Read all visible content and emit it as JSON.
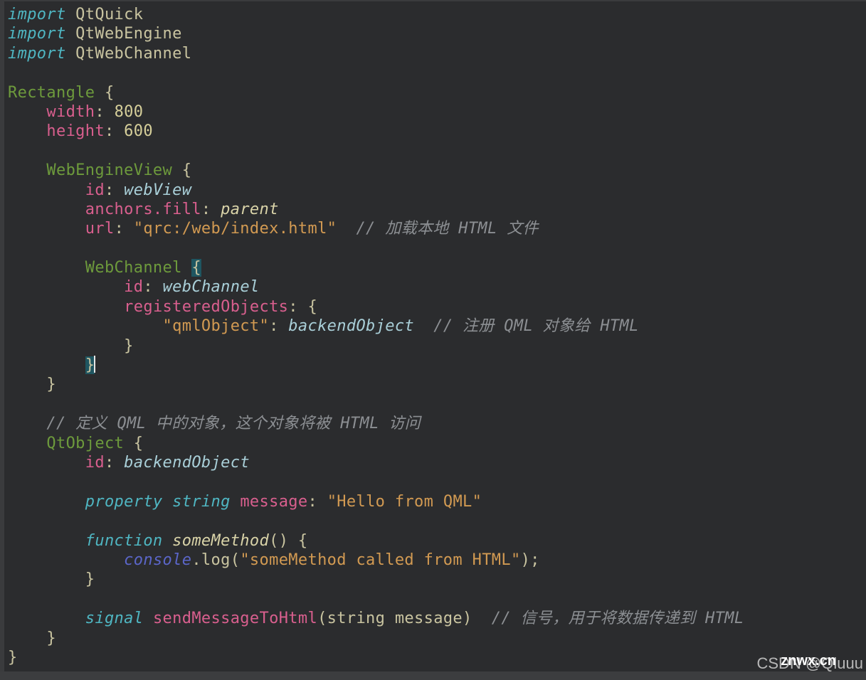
{
  "editor": {
    "language": "QML",
    "lines": [
      [
        {
          "t": "import",
          "c": "kw"
        },
        {
          "t": " QtQuick",
          "c": "plain"
        }
      ],
      [
        {
          "t": "import",
          "c": "kw"
        },
        {
          "t": " QtWebEngine",
          "c": "plain"
        }
      ],
      [
        {
          "t": "import",
          "c": "kw"
        },
        {
          "t": " QtWebChannel",
          "c": "plain"
        }
      ],
      [],
      [
        {
          "t": "Rectangle",
          "c": "type"
        },
        {
          "t": " {",
          "c": "plain"
        }
      ],
      [
        {
          "t": "    "
        },
        {
          "t": "width",
          "c": "prop"
        },
        {
          "t": ": ",
          "c": "plain"
        },
        {
          "t": "800",
          "c": "num"
        }
      ],
      [
        {
          "t": "    "
        },
        {
          "t": "height",
          "c": "prop"
        },
        {
          "t": ": ",
          "c": "plain"
        },
        {
          "t": "600",
          "c": "num"
        }
      ],
      [],
      [
        {
          "t": "    "
        },
        {
          "t": "WebEngineView",
          "c": "type"
        },
        {
          "t": " {",
          "c": "plain"
        }
      ],
      [
        {
          "t": "        "
        },
        {
          "t": "id",
          "c": "prop"
        },
        {
          "t": ": ",
          "c": "plain"
        },
        {
          "t": "webView",
          "c": "ital"
        }
      ],
      [
        {
          "t": "        "
        },
        {
          "t": "anchors.fill",
          "c": "prop"
        },
        {
          "t": ": ",
          "c": "plain"
        },
        {
          "t": "parent",
          "c": "fn"
        }
      ],
      [
        {
          "t": "        "
        },
        {
          "t": "url",
          "c": "prop"
        },
        {
          "t": ": ",
          "c": "plain"
        },
        {
          "t": "\"qrc:/web/index.html\"",
          "c": "str"
        },
        {
          "t": "  // 加载本地 HTML 文件",
          "c": "com"
        }
      ],
      [],
      [
        {
          "t": "        "
        },
        {
          "t": "WebChannel",
          "c": "type"
        },
        {
          "t": " ",
          "c": "plain"
        },
        {
          "t": "{",
          "c": "plain brace-hl"
        }
      ],
      [
        {
          "t": "            "
        },
        {
          "t": "id",
          "c": "prop"
        },
        {
          "t": ": ",
          "c": "plain"
        },
        {
          "t": "webChannel",
          "c": "ital"
        }
      ],
      [
        {
          "t": "            "
        },
        {
          "t": "registeredObjects",
          "c": "prop"
        },
        {
          "t": ": {",
          "c": "plain"
        }
      ],
      [
        {
          "t": "                "
        },
        {
          "t": "\"qmlObject\"",
          "c": "str"
        },
        {
          "t": ": ",
          "c": "plain"
        },
        {
          "t": "backendObject",
          "c": "ital"
        },
        {
          "t": "  // 注册 QML 对象给 HTML",
          "c": "com"
        }
      ],
      [
        {
          "t": "            "
        },
        {
          "t": "}",
          "c": "plain"
        }
      ],
      [
        {
          "t": "        "
        },
        {
          "t": "}",
          "c": "plain brace-hl"
        },
        {
          "t": "",
          "c": "cursor"
        }
      ],
      [
        {
          "t": "    "
        },
        {
          "t": "}",
          "c": "plain"
        }
      ],
      [],
      [
        {
          "t": "    "
        },
        {
          "t": "// 定义 QML 中的对象，这个对象将被 HTML 访问",
          "c": "com"
        }
      ],
      [
        {
          "t": "    "
        },
        {
          "t": "QtObject",
          "c": "type"
        },
        {
          "t": " {",
          "c": "plain"
        }
      ],
      [
        {
          "t": "        "
        },
        {
          "t": "id",
          "c": "prop"
        },
        {
          "t": ": ",
          "c": "plain"
        },
        {
          "t": "backendObject",
          "c": "ital"
        }
      ],
      [],
      [
        {
          "t": "        "
        },
        {
          "t": "property",
          "c": "kw"
        },
        {
          "t": " "
        },
        {
          "t": "string",
          "c": "kw"
        },
        {
          "t": " "
        },
        {
          "t": "message",
          "c": "prop"
        },
        {
          "t": ": ",
          "c": "plain"
        },
        {
          "t": "\"Hello from QML\"",
          "c": "str"
        }
      ],
      [],
      [
        {
          "t": "        "
        },
        {
          "t": "function",
          "c": "kw"
        },
        {
          "t": " "
        },
        {
          "t": "someMethod",
          "c": "fn"
        },
        {
          "t": "() {",
          "c": "plain"
        }
      ],
      [
        {
          "t": "            "
        },
        {
          "t": "console",
          "c": "con"
        },
        {
          "t": ".log(",
          "c": "plain"
        },
        {
          "t": "\"someMethod called from HTML\"",
          "c": "str"
        },
        {
          "t": ");",
          "c": "plain"
        }
      ],
      [
        {
          "t": "        "
        },
        {
          "t": "}",
          "c": "plain"
        }
      ],
      [],
      [
        {
          "t": "        "
        },
        {
          "t": "signal",
          "c": "kw"
        },
        {
          "t": " "
        },
        {
          "t": "sendMessageToHtml",
          "c": "prop"
        },
        {
          "t": "(string message)",
          "c": "plain"
        },
        {
          "t": "  // 信号，用于将数据传递到 HTML",
          "c": "com"
        }
      ],
      [
        {
          "t": "    "
        },
        {
          "t": "}",
          "c": "plain"
        }
      ],
      [
        {
          "t": "}",
          "c": "plain"
        }
      ]
    ]
  },
  "watermark": {
    "text": "CSDN @Qluuu",
    "overlay": "znwx.cn"
  }
}
